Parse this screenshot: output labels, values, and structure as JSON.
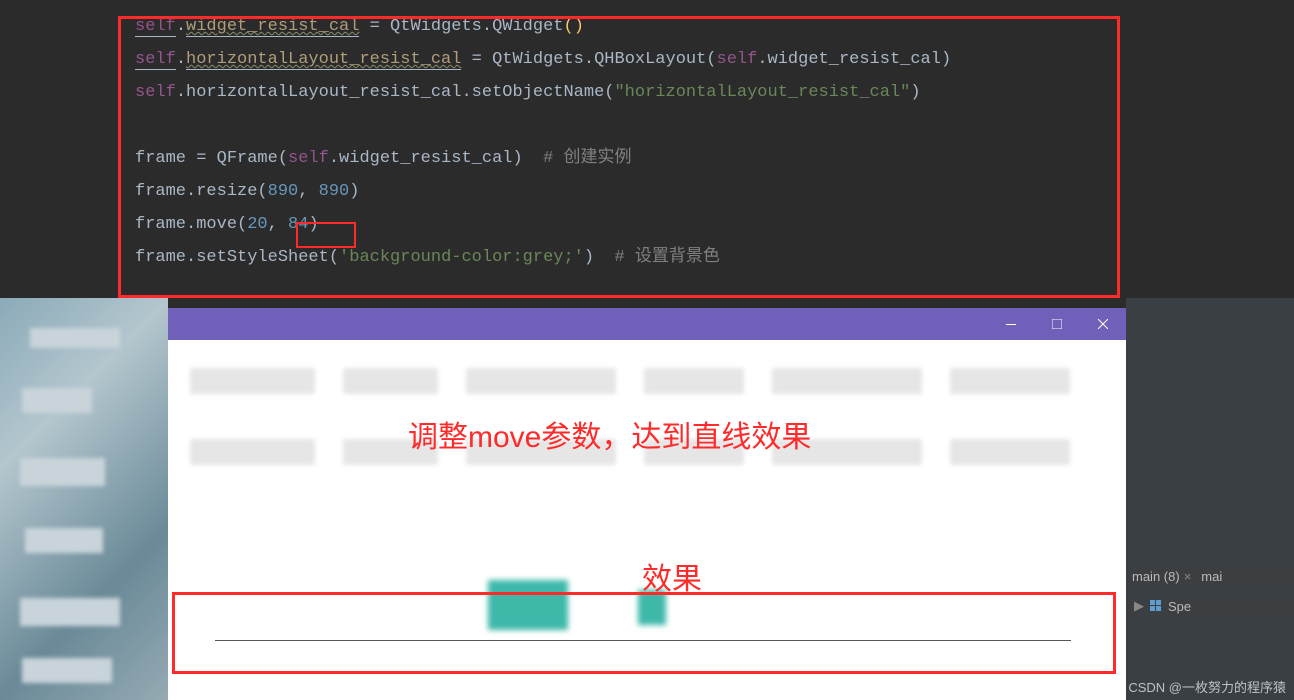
{
  "code": {
    "l1": {
      "p1": "self",
      "p2": ".",
      "p3": "widget_resist_cal",
      "p4": " = QtWidgets.QWidget",
      "p5": "()"
    },
    "l2": {
      "p1": "self",
      "p2": ".",
      "p3": "horizontalLayout_resist_cal",
      "p4": " = QtWidgets.QHBoxLayout(",
      "p5": "self",
      "p6": ".widget_resist_cal)"
    },
    "l3": {
      "p1": "self",
      "p2": ".horizontalLayout_resist_cal.setObjectName(",
      "p3": "\"horizontalLayout_resist_cal\"",
      "p4": ")"
    },
    "l4": "",
    "l5": {
      "p1": "frame = QFrame(",
      "p2": "self",
      "p3": ".widget_resist_cal)  ",
      "c": "# 创建实例"
    },
    "l6": {
      "p1": "frame.resize(",
      "p2": "890",
      "p3": ", ",
      "p4": "890",
      "p5": ")"
    },
    "l7": {
      "p1": "frame.move(",
      "p2": "20",
      "p3": ", ",
      "p4": "84",
      "p5": ")"
    },
    "l8": {
      "p1": "frame.setStyleSheet(",
      "p2": "'background-color:grey;'",
      "p3": ")  ",
      "c": "# 设置背景色"
    }
  },
  "annotations": {
    "line1": "调整move参数，达到直线效果",
    "line2": "效果"
  },
  "rightPanel": {
    "tab1": "main (8)",
    "tab2": "mai",
    "specLabel": "Spe"
  },
  "watermark": "CSDN @一枚努力的程序猿"
}
